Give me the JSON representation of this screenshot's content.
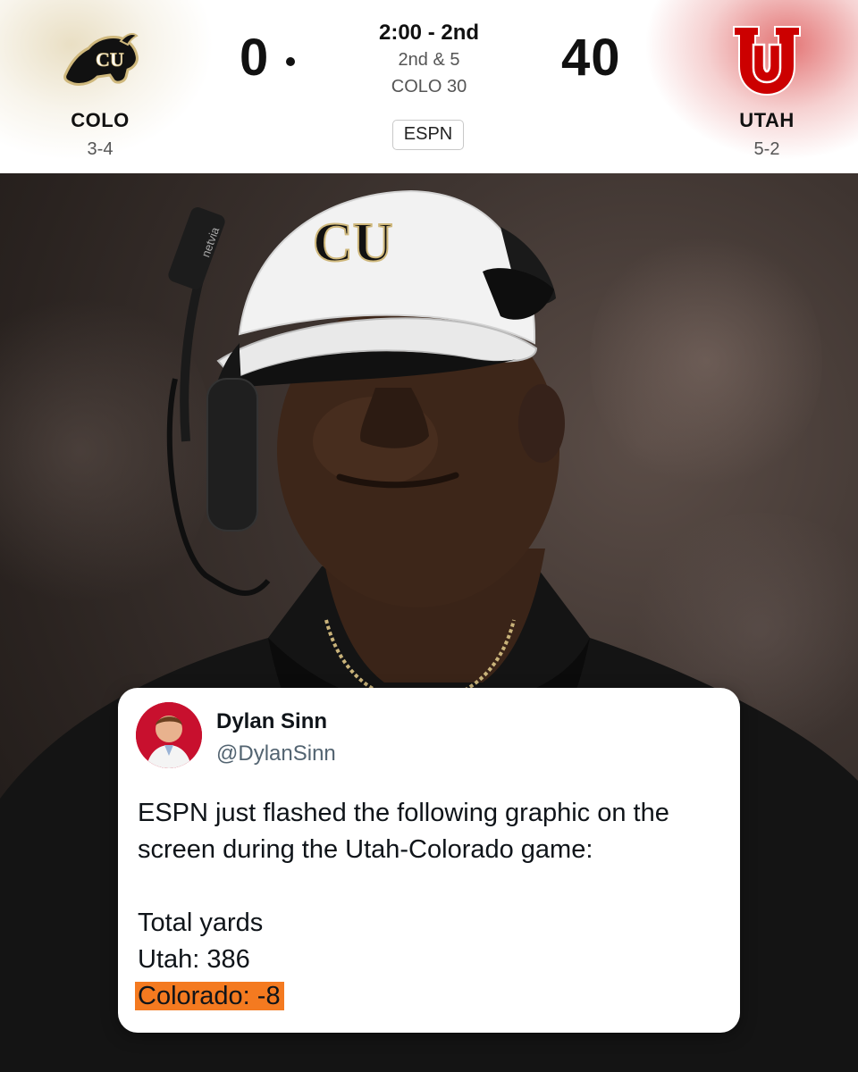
{
  "scoreboard": {
    "away": {
      "abbr": "COLO",
      "record": "3-4",
      "score": "0",
      "logo_icon": "cu-buffalo-logo-icon",
      "color": "#cfb87c"
    },
    "home": {
      "abbr": "UTAH",
      "record": "5-2",
      "score": "40",
      "logo_icon": "utah-u-logo-icon",
      "color": "#cc0000"
    },
    "clock": "2:00 - 2nd",
    "down_distance": "2nd & 5",
    "ball_spot": "COLO 30",
    "network": "ESPN"
  },
  "photo": {
    "cap_logo_icon": "cu-monogram-icon",
    "headset_brand": "netvia"
  },
  "tweet": {
    "author_name": "Dylan Sinn",
    "author_handle": "@DylanSinn",
    "lines": [
      "ESPN just flashed the following graphic on the",
      "screen during the Utah-Colorado game:",
      "Total yards",
      "Utah: 386",
      "Colorado: -8"
    ],
    "highlight_color": "#f47a20"
  }
}
